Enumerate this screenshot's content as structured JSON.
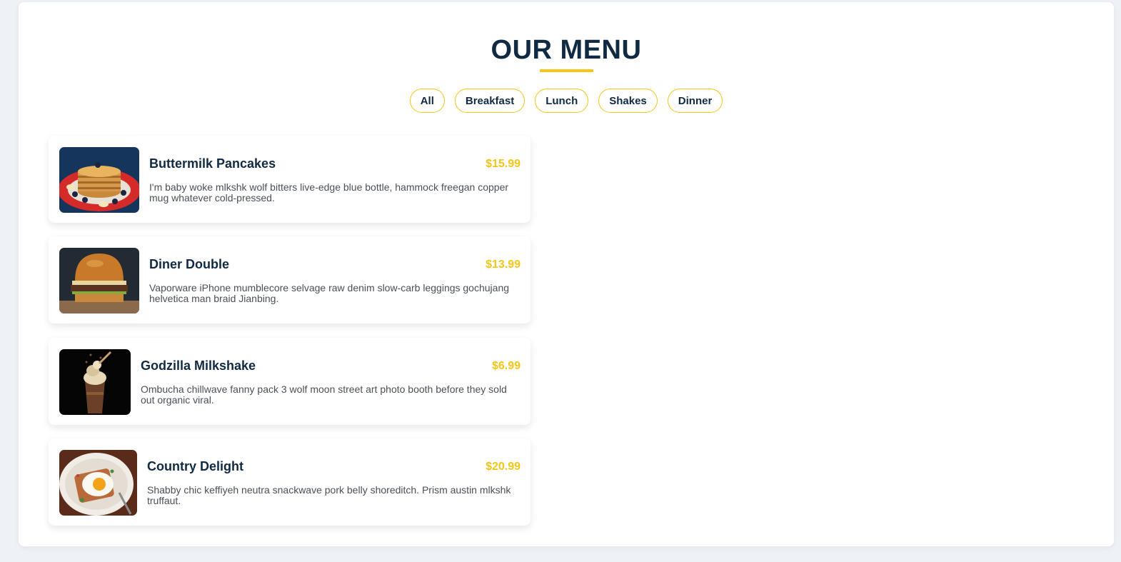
{
  "menu": {
    "title": "OUR MENU",
    "filters": [
      "All",
      "Breakfast",
      "Lunch",
      "Shakes",
      "Dinner"
    ],
    "items": [
      {
        "name": "Buttermilk Pancakes",
        "price": "$15.99",
        "description": "I'm baby woke mlkshk wolf bitters live-edge blue bottle, hammock freegan copper mug whatever cold-pressed.",
        "image": "pancakes-image"
      },
      {
        "name": "Diner Double",
        "price": "$13.99",
        "description": "Vaporware iPhone mumblecore selvage raw denim slow-carb leggings gochujang helvetica man braid Jianbing.",
        "image": "burger-image"
      },
      {
        "name": "Godzilla Milkshake",
        "price": "$6.99",
        "description": "Ombucha chillwave fanny pack 3 wolf moon street art photo booth before they sold out organic viral.",
        "image": "milkshake-image"
      },
      {
        "name": "Country Delight",
        "price": "$20.99",
        "description": "Shabby chic keffiyeh neutra snackwave pork belly shoreditch. Prism austin mlkshk truffaut.",
        "image": "fried-egg-toast-image"
      }
    ]
  },
  "colors": {
    "accent": "#f5c518",
    "heading": "#102a43",
    "body_text": "#4a4f58",
    "page_bg": "#eef1f6"
  }
}
